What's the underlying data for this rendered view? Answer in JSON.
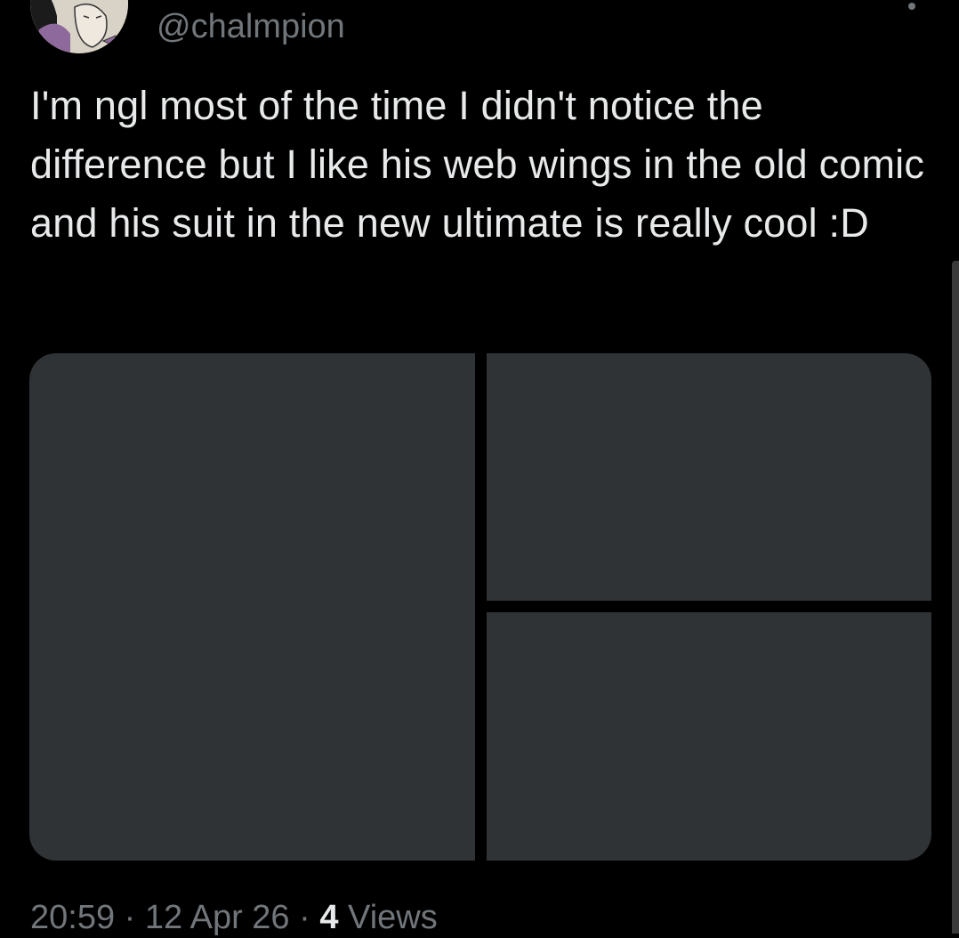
{
  "tweet": {
    "handle": "@chalmpion",
    "text": "I'm ngl most of the time I didn't notice the difference but I like his web wings in the old comic and his suit in the new ultimate is really cool :D",
    "time": "20:59",
    "separator": "·",
    "date": "12 Apr 26",
    "views_count": "4",
    "views_label": "Views"
  },
  "media": {
    "count": 3
  },
  "icons": {
    "avatar": "avatar-illustration",
    "more": "more-options-icon"
  },
  "colors": {
    "background": "#000000",
    "text_primary": "#e7e9ea",
    "text_secondary": "#71767b",
    "media_placeholder": "#303336"
  }
}
